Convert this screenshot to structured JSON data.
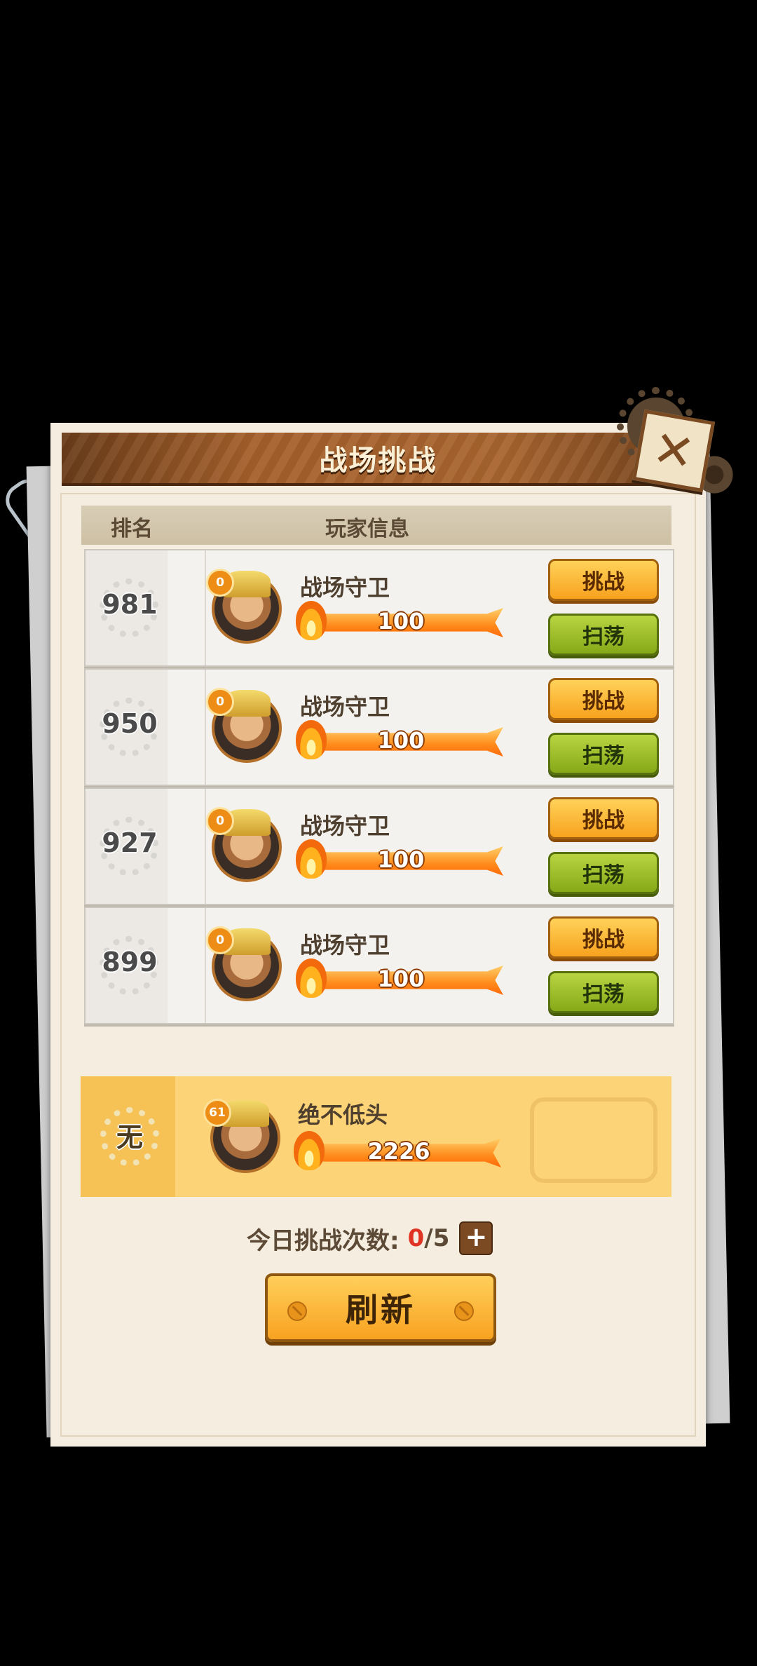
{
  "title": "战场挑战",
  "header": {
    "rank_label": "排名",
    "player_label": "玩家信息"
  },
  "entries": [
    {
      "rank": "981",
      "level": "0",
      "name": "战场守卫",
      "power": "100",
      "challenge_label": "挑战",
      "sweep_label": "扫荡"
    },
    {
      "rank": "950",
      "level": "0",
      "name": "战场守卫",
      "power": "100",
      "challenge_label": "挑战",
      "sweep_label": "扫荡"
    },
    {
      "rank": "927",
      "level": "0",
      "name": "战场守卫",
      "power": "100",
      "challenge_label": "挑战",
      "sweep_label": "扫荡"
    },
    {
      "rank": "899",
      "level": "0",
      "name": "战场守卫",
      "power": "100",
      "challenge_label": "挑战",
      "sweep_label": "扫荡"
    }
  ],
  "me": {
    "rank": "无",
    "level": "61",
    "name": "绝不低头",
    "power": "2226"
  },
  "daily": {
    "label": "今日挑战次数:",
    "used": "0",
    "total": "/5"
  },
  "refresh_label": "刷新",
  "close_icon": "close-icon",
  "colors": {
    "challenge": "#f7a21e",
    "sweep": "#86a918",
    "title_bar": "#a5602b",
    "used_count": "#e03324"
  }
}
